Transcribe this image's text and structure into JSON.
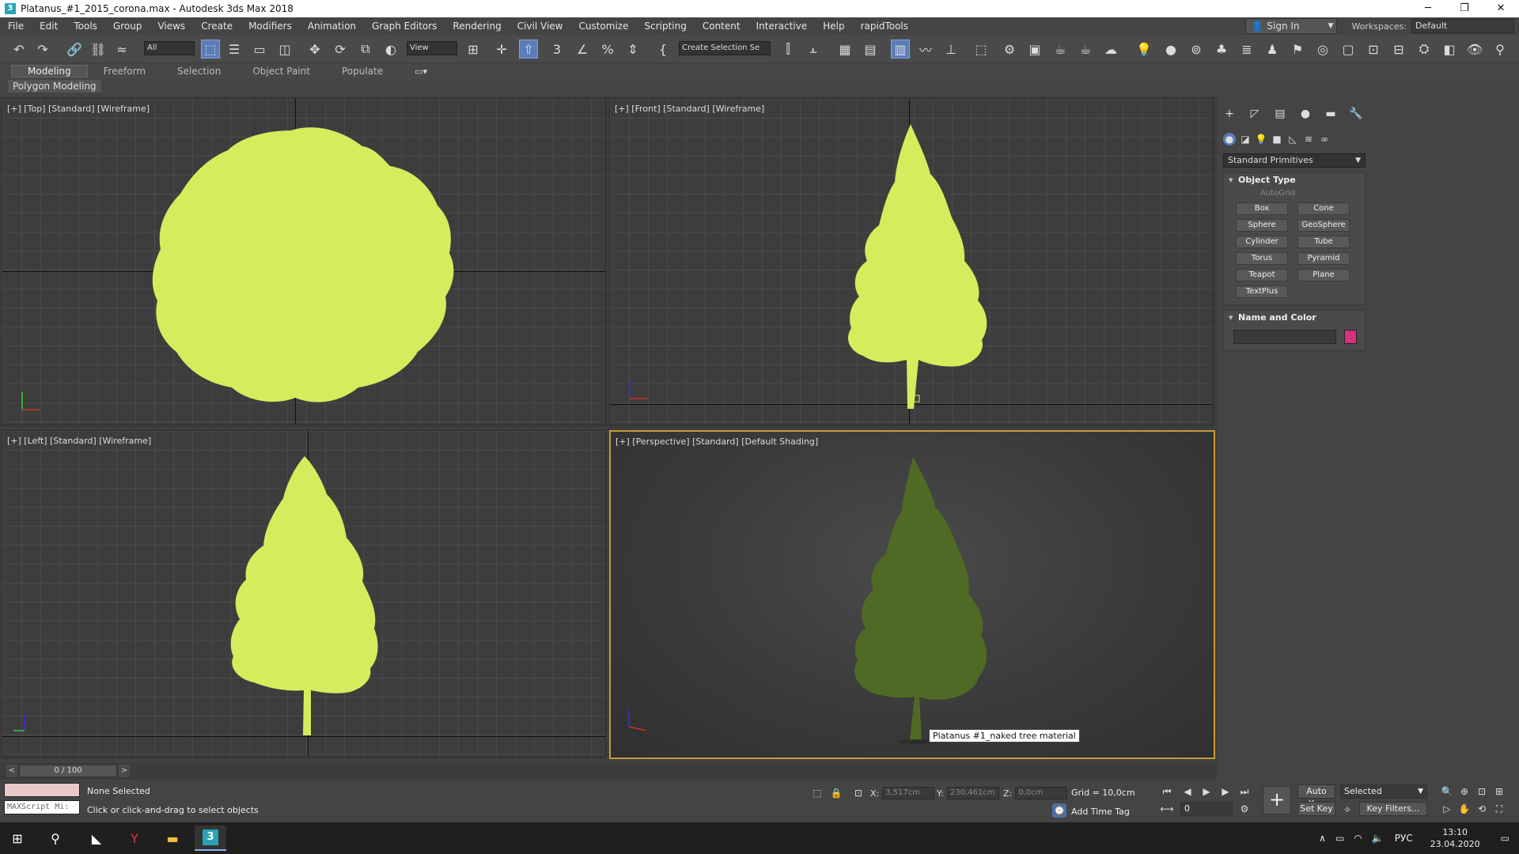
{
  "window": {
    "title": "Platanus_#1_2015_corona.max - Autodesk 3ds Max 2018",
    "minimize": "─",
    "restore": "❐",
    "close": "✕"
  },
  "menu": {
    "items": [
      "File",
      "Edit",
      "Tools",
      "Group",
      "Views",
      "Create",
      "Modifiers",
      "Animation",
      "Graph Editors",
      "Rendering",
      "Civil View",
      "Customize",
      "Scripting",
      "Content",
      "Interactive",
      "Help",
      "rapidTools"
    ],
    "sign_in": "Sign In",
    "workspaces_label": "Workspaces:",
    "workspace_value": "Default"
  },
  "toolbar": {
    "filter_value": "All",
    "ref_coord_value": "View",
    "selection_set_value": "Create Selection Se"
  },
  "ribbon": {
    "tabs": [
      "Modeling",
      "Freeform",
      "Selection",
      "Object Paint",
      "Populate"
    ],
    "sub_label": "Polygon Modeling"
  },
  "viewports": {
    "top_label": "[+] [Top] [Standard] [Wireframe]",
    "front_label": "[+] [Front] [Standard] [Wireframe]",
    "left_label": "[+] [Left] [Standard] [Wireframe]",
    "persp_label": "[+] [Perspective] [Standard] [Default Shading]",
    "tooltip": "Platanus #1_naked tree material",
    "foliage_color": "#d6ec5c",
    "persp_foliage_color": "#4f6a25"
  },
  "command_panel": {
    "category": "Standard Primitives",
    "object_type_title": "Object Type",
    "autogrid": "AutoGrid",
    "primitives": [
      "Box",
      "Cone",
      "Sphere",
      "GeoSphere",
      "Cylinder",
      "Tube",
      "Torus",
      "Pyramid",
      "Teapot",
      "Plane",
      "TextPlus"
    ],
    "name_color_title": "Name and Color",
    "object_color": "#d4307d"
  },
  "timeline": {
    "frame": "0 / 100",
    "prev": "<",
    "next": ">"
  },
  "status": {
    "maxscript": "MAXScript Mi:",
    "selection": "None Selected",
    "prompt": "Click or click-and-drag to select objects",
    "x_label": "X:",
    "x_value": "3,517cm",
    "y_label": "Y:",
    "y_value": "230,461cm",
    "z_label": "Z:",
    "z_value": "0,0cm",
    "grid": "Grid = 10,0cm",
    "add_time_tag": "Add Time Tag",
    "auto_key": "Auto Key",
    "set_key": "Set Key",
    "selected_value": "Selected",
    "key_filters": "Key Filters...",
    "frame_spinner": "0"
  },
  "taskbar": {
    "lang": "РУС",
    "time": "13:10",
    "date": "23.04.2020"
  }
}
